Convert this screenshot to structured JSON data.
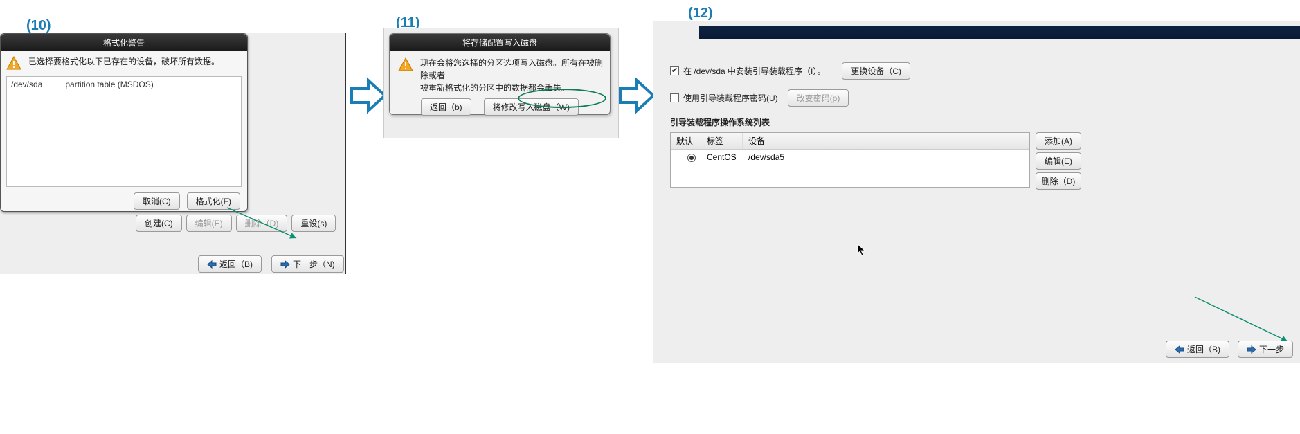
{
  "steps": {
    "s10": "(10)",
    "s11": "(11)",
    "s12": "(12)"
  },
  "dialog10": {
    "title": "格式化警告",
    "message": "已选择要格式化以下已存在的设备，破坏所有数据。",
    "row_device": "/dev/sda",
    "row_desc": "partition table (MSDOS)",
    "cancel": "取消(C)",
    "format": "格式化(F)"
  },
  "parent_buttons": {
    "create": "创建(C)",
    "edit": "编辑(E)",
    "delete": "删除（D)",
    "reset": "重设(s)"
  },
  "nav": {
    "back": "返回（B)",
    "next": "下一步（N)"
  },
  "dialog11": {
    "title": "将存储配置写入磁盘",
    "msg_line1": "现在会将您选择的分区选项写入磁盘。所有在被删除或者",
    "msg_line2": "被重新格式化的分区中的数据都会丢失。",
    "back": "返回（b)",
    "write": "将修改写入磁盘（W)"
  },
  "panel12": {
    "chk1_prefix": "在 ",
    "chk1_mid": "/dev/sda 中安装引导装载程序（I）。",
    "change_device": "更换设备（C)",
    "chk2": "使用引导装载程序密码(U)",
    "change_pw": "改变密码(p)",
    "list_label": "引导装载程序操作系统列表",
    "th_default": "默认",
    "th_label": "标签",
    "th_device": "设备",
    "row_label": "CentOS",
    "row_device": "/dev/sda5",
    "add": "添加(A)",
    "edit": "编辑(E)",
    "delete": "删除（D)",
    "back": "返回（B)",
    "next": "下一步"
  }
}
